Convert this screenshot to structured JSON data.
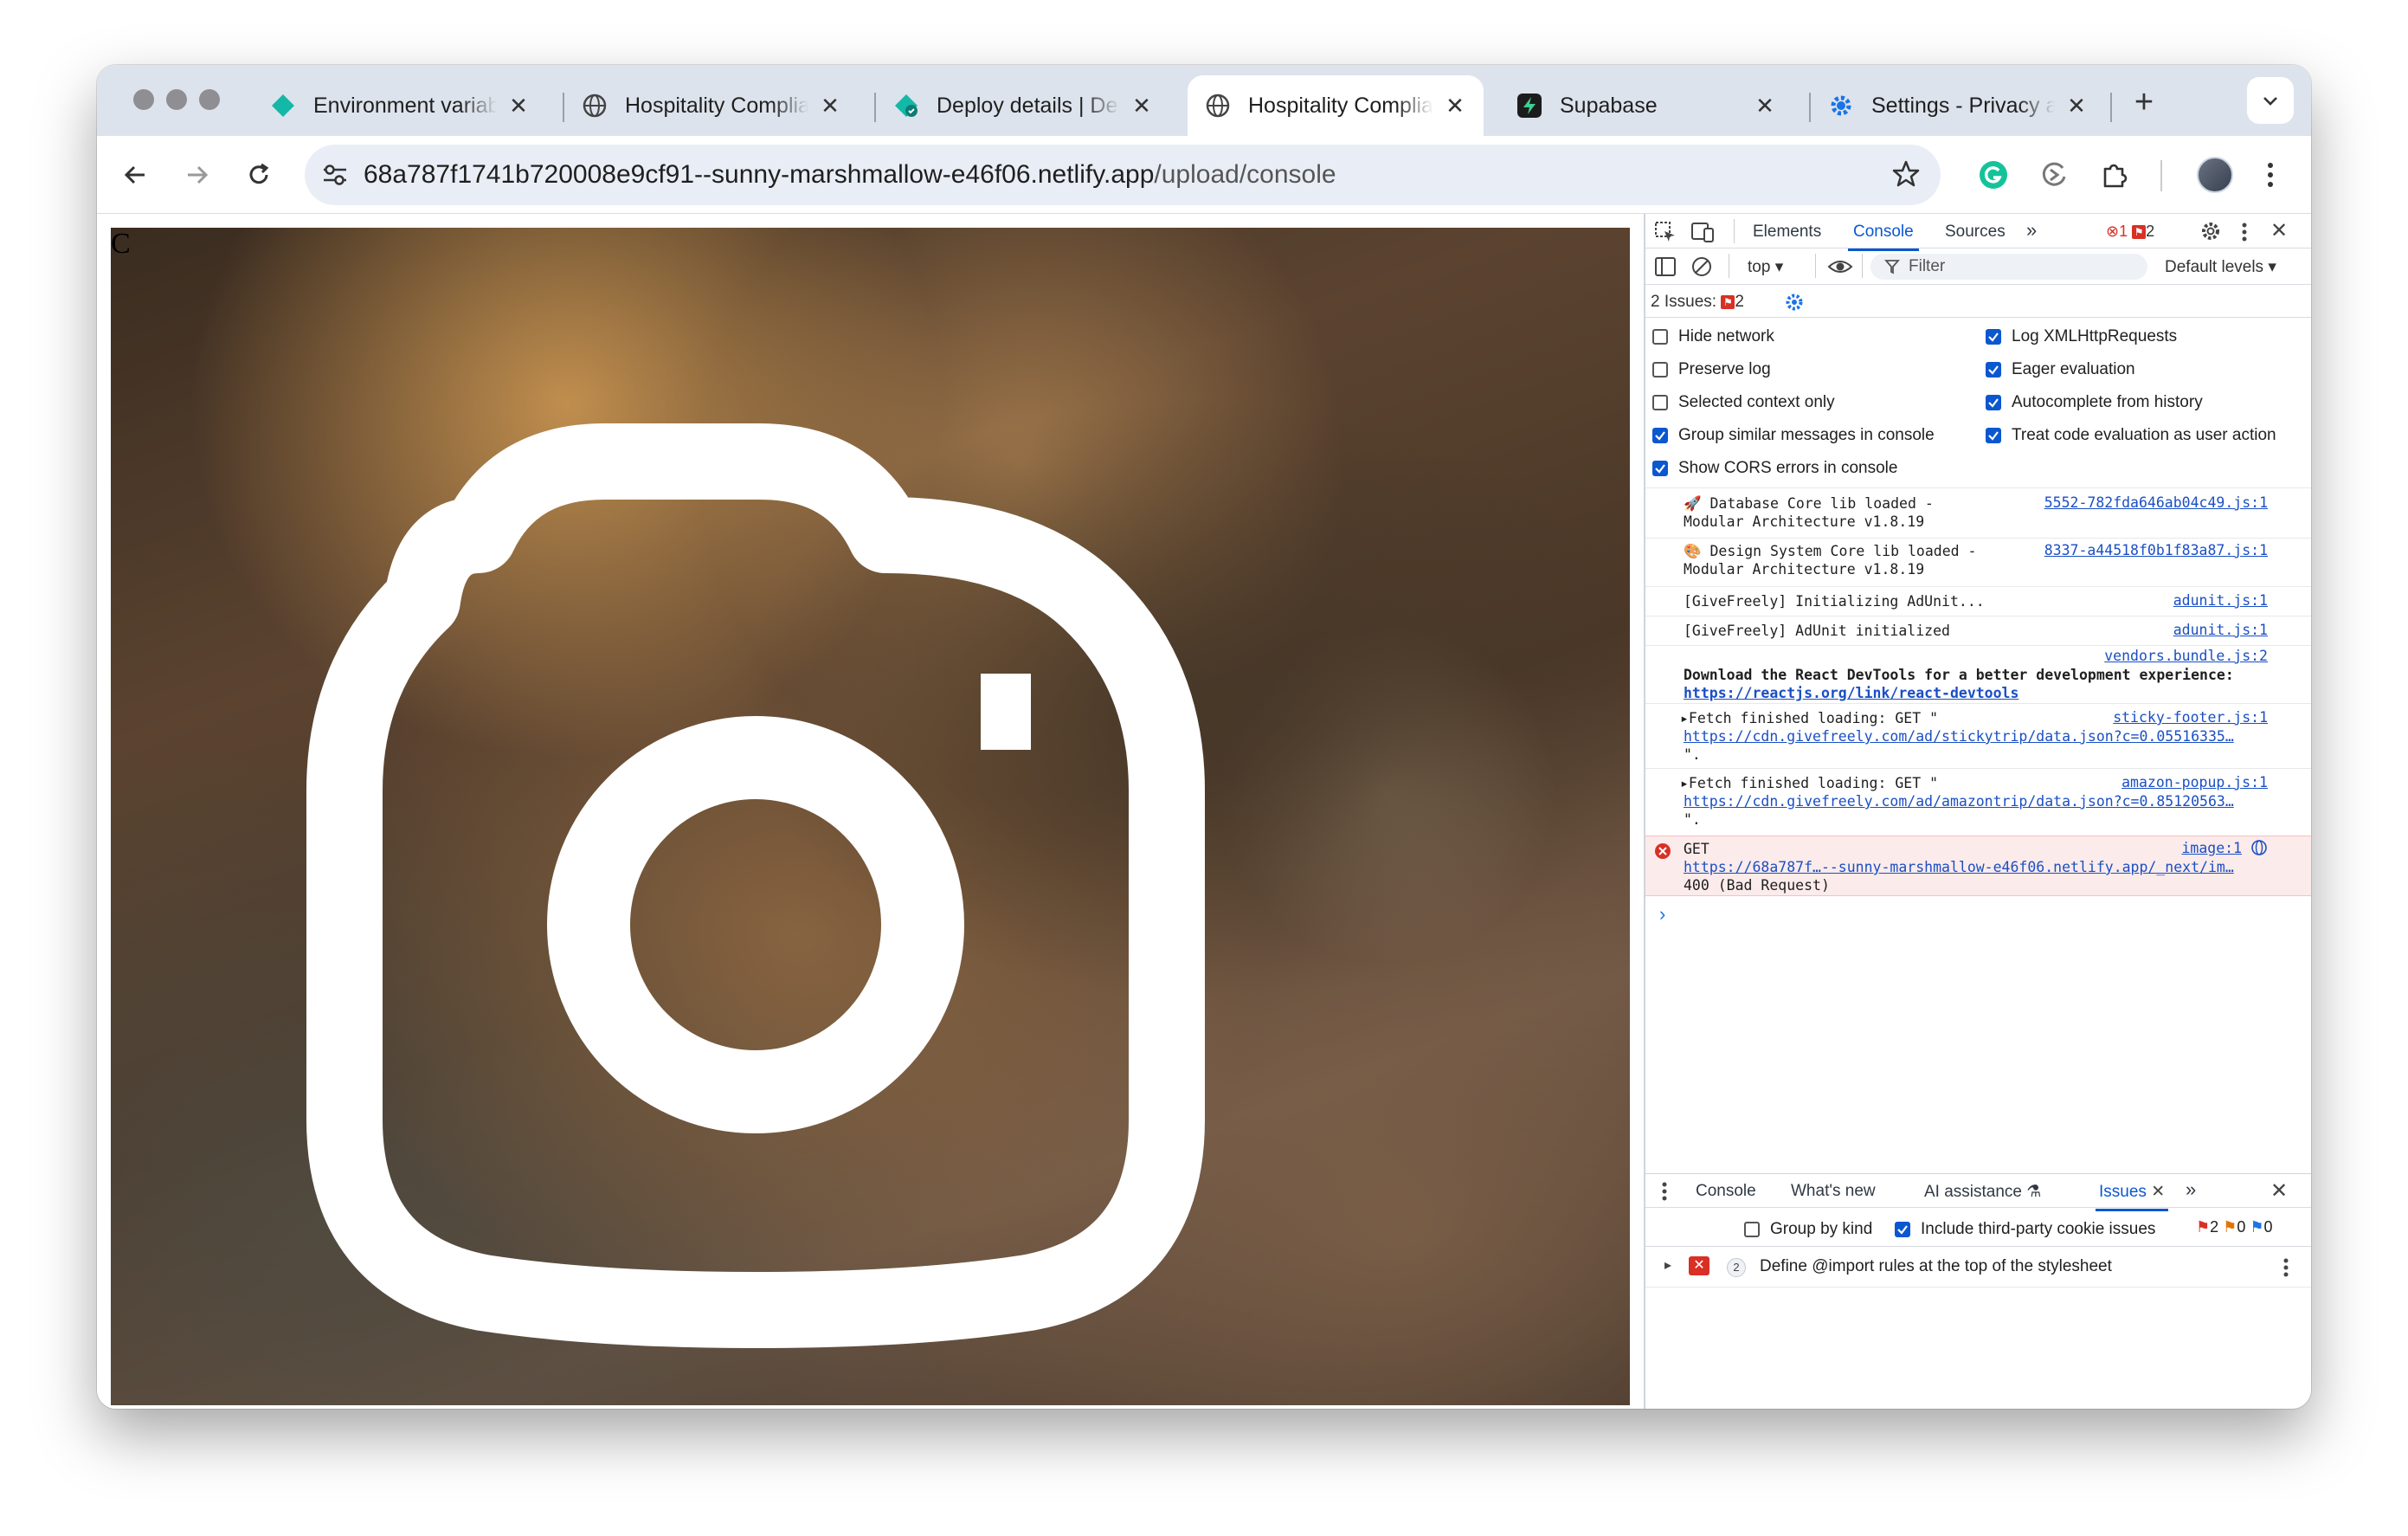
{
  "browser": {
    "tabs": [
      {
        "title": "Environment variab",
        "icon": "netlify-diamond-icon",
        "active": false
      },
      {
        "title": "Hospitality Complia",
        "icon": "globe-icon",
        "active": false
      },
      {
        "title": "Deploy details | De",
        "icon": "netlify-deploy-icon",
        "active": false
      },
      {
        "title": "Hospitality Complia",
        "icon": "globe-icon",
        "active": true
      },
      {
        "title": "Supabase",
        "icon": "supabase-icon",
        "active": false
      },
      {
        "title": "Settings - Privacy a",
        "icon": "gear-icon",
        "active": false
      }
    ],
    "new_tab": "+",
    "url_host": "68a787f1741b720008e9cf91--sunny-marshmallow-e46f06.netlify.app",
    "url_path": "/upload/console",
    "colors": {
      "tabstrip": "#dde3ec",
      "omnibox": "#e9eef6",
      "accent": "#0b57d0"
    }
  },
  "page": {
    "letter": "C",
    "image_icon": "camera-icon"
  },
  "devtools": {
    "tabs": {
      "elements": "Elements",
      "console": "Console",
      "sources": "Sources",
      "more": "»"
    },
    "error_count": "1",
    "issue_count": "2",
    "context": "top ▾",
    "filter_placeholder": "Filter",
    "levels": "Default levels ▾",
    "issues_label": "2 Issues:",
    "issues_badge": "2",
    "settings_left": [
      {
        "label": "Hide network",
        "checked": false
      },
      {
        "label": "Preserve log",
        "checked": false
      },
      {
        "label": "Selected context only",
        "checked": false
      },
      {
        "label": "Group similar messages in console",
        "checked": true
      },
      {
        "label": "Show CORS errors in console",
        "checked": true
      }
    ],
    "settings_right": [
      {
        "label": "Log XMLHttpRequests",
        "checked": true
      },
      {
        "label": "Eager evaluation",
        "checked": true
      },
      {
        "label": "Autocomplete from history",
        "checked": true
      },
      {
        "label": "Treat code evaluation as user action",
        "checked": true
      }
    ],
    "logs": [
      {
        "text": "🚀 Database Core lib loaded -\nModular Architecture v1.8.19",
        "source": "5552-782fda646ab04c49.js:1"
      },
      {
        "text": "🎨 Design System Core lib loaded -\nModular Architecture v1.8.19",
        "source": "8337-a44518f0b1f83a87.js:1"
      },
      {
        "text": "[GiveFreely] Initializing AdUnit...",
        "source": "adunit.js:1"
      },
      {
        "text": "[GiveFreely] AdUnit initialized",
        "source": "adunit.js:1"
      },
      {
        "source": "vendors.bundle.js:2",
        "bold": "Download the React DevTools for a better development experience:",
        "link": "https://reactjs.org/link/react-devtools"
      },
      {
        "text": "▸Fetch finished loading: GET \"",
        "source": "sticky-footer.js:1",
        "link": "https://cdn.givefreely.com/ad/stickytrip/data.json?c=0.05516335…",
        "tail": "\"."
      },
      {
        "text": "▸Fetch finished loading: GET \"",
        "source": "amazon-popup.js:1",
        "link": "https://cdn.givefreely.com/ad/amazontrip/data.json?c=0.85120563…",
        "tail": "\"."
      },
      {
        "text": "GET",
        "source": "image:1",
        "link": "https://68a787f…--sunny-marshmallow-e46f06.netlify.app/_next/im…",
        "tail": "400 (Bad Request)",
        "error": true
      }
    ],
    "prompt": "›",
    "drawer_tabs": [
      "Console",
      "What's new",
      "AI assistance",
      "Issues"
    ],
    "drawer_more": "»",
    "drawer_options": {
      "group_by_kind": {
        "label": "Group by kind",
        "checked": false
      },
      "third_party": {
        "label": "Include third-party cookie issues",
        "checked": true
      },
      "counts": {
        "errors": "2",
        "warnings": "0",
        "info": "0"
      }
    },
    "issue_row": {
      "count": "2",
      "text": "Define @import rules at the top of the stylesheet"
    }
  }
}
